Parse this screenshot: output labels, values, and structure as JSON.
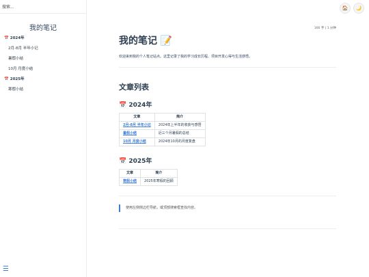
{
  "search": {
    "placeholder": "搜索..."
  },
  "sidebar": {
    "title": "我的笔记",
    "groups": [
      {
        "year": "📅 2024年",
        "items": [
          "2月-8月 半年小记",
          "暑假小结",
          "10月 月度小结"
        ]
      },
      {
        "year": "📅 2025年",
        "items": [
          "寒假小结"
        ]
      }
    ]
  },
  "menu": {
    "icon": "☰"
  },
  "top": {
    "home_icon": "🏠",
    "theme_icon": "🌙"
  },
  "meta": {
    "wordcount": "166 字 | 1 分钟"
  },
  "main": {
    "title": "我的笔记 📝",
    "intro": "欢迎来到我的个人笔记站点。这里记录了我的学习成长历程、项目开发心得与生活感悟。",
    "list_title": "文章列表",
    "headers": [
      "文章",
      "简介"
    ],
    "sections": [
      {
        "year": "📅 2024年",
        "rows": [
          {
            "title": "2月-8月 半年小记",
            "desc": "2024年上半年的收获与感悟"
          },
          {
            "title": "暑假小结",
            "desc": "近三个月暑假的总结"
          },
          {
            "title": "10月 月度小结",
            "desc": "2024年10月的月度复盘"
          }
        ]
      },
      {
        "year": "📅 2025年",
        "rows": [
          {
            "title": "寒假小结",
            "desc": "2025年寒假的回顾"
          }
        ]
      }
    ],
    "tip": "使用左侧侧边栏导航，或顶部搜索框查找内容。"
  }
}
